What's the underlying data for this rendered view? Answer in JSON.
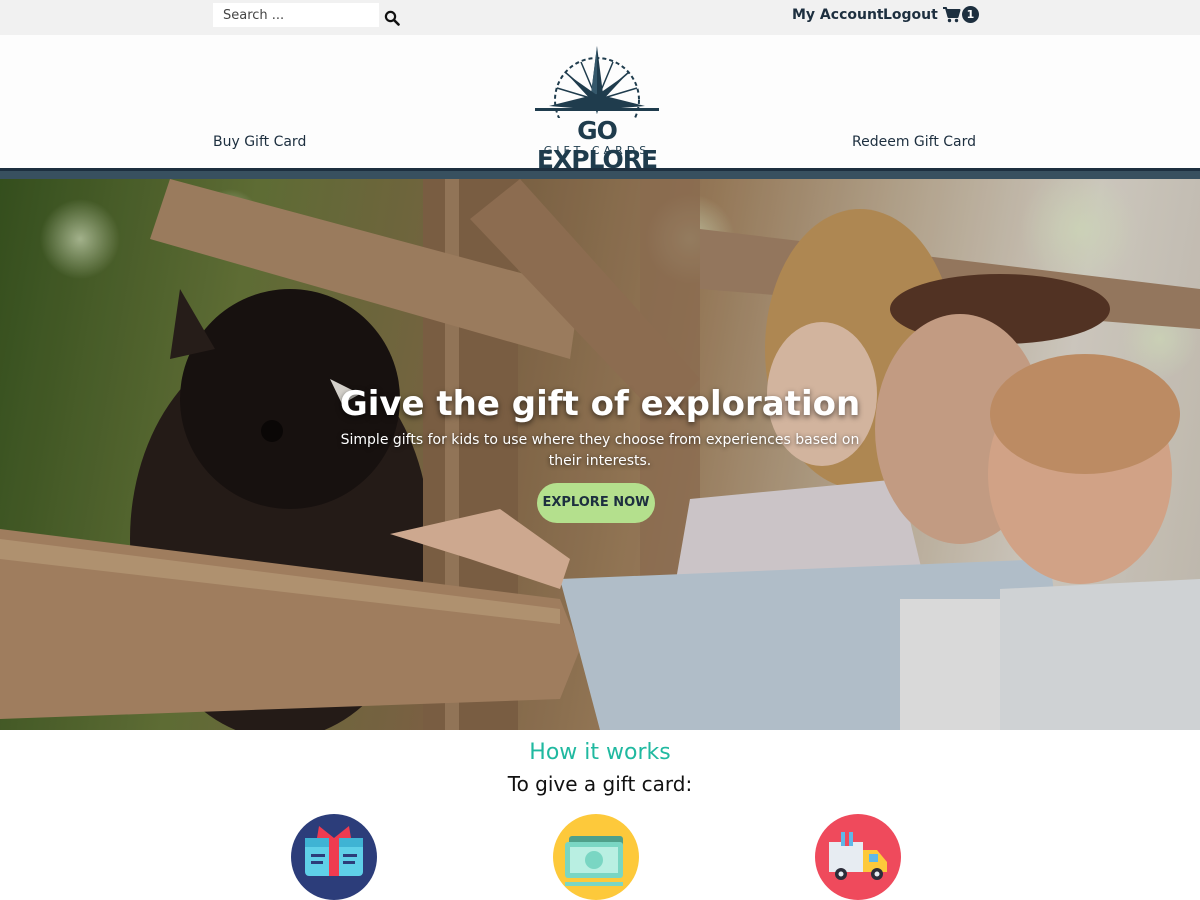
{
  "topbar": {
    "search_placeholder": "Search ...",
    "my_account": "My Account",
    "logout": "Logout",
    "cart_count": "1"
  },
  "header": {
    "nav_left": "Buy Gift Card",
    "nav_right": "Redeem Gift Card",
    "logo_word": "GO EXPLORE",
    "logo_sub": "GIFT CARDS"
  },
  "hero": {
    "title": "Give the gift of exploration",
    "subtitle": "Simple gifts for kids to use where they choose from experiences based on their interests.",
    "cta": "EXPLORE NOW"
  },
  "how": {
    "title": "How it works",
    "subtitle": "To give a gift card:",
    "steps": [
      {
        "icon": "gift-card-icon"
      },
      {
        "icon": "money-icon"
      },
      {
        "icon": "delivery-truck-icon"
      }
    ]
  },
  "colors": {
    "brand_dark": "#1d2f3f",
    "accent_teal": "#20b9a0",
    "cta_green": "#b4e08d"
  }
}
